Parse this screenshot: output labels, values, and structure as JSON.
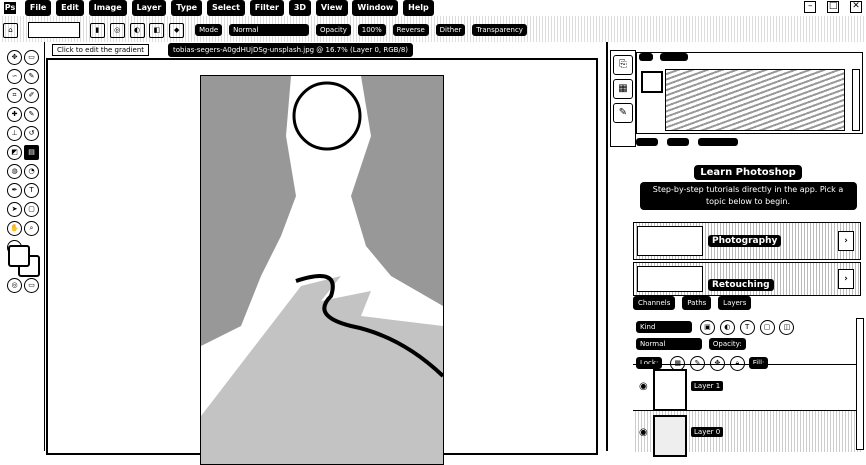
{
  "menubar": {
    "logo": "Ps",
    "items": [
      "File",
      "Edit",
      "Image",
      "Layer",
      "Type",
      "Select",
      "Filter",
      "3D",
      "View",
      "Window",
      "Help"
    ],
    "window_controls": [
      "–",
      "□",
      "✕"
    ]
  },
  "options": {
    "items": [
      "Mode",
      "Normal",
      "Opacity",
      "100%",
      "Reverse",
      "Dither",
      "Transparency"
    ]
  },
  "tooltip": {
    "text": "Click to edit the gradient"
  },
  "document": {
    "tab_label": "tobias-segers-A0gdHUjDSg-unsplash.jpg @ 16.7% (Layer 0, RGB/8)"
  },
  "side_strip": {
    "icons": [
      "history-icon",
      "libraries-icon",
      "brush-icon"
    ]
  },
  "learn": {
    "tabs": [
      "",
      "",
      ""
    ],
    "title": "Learn Photoshop",
    "body": "Step-by-step tutorials directly in the app. Pick a topic below to begin.",
    "topics": [
      {
        "label": "Photography"
      },
      {
        "label": "Retouching"
      }
    ]
  },
  "layers": {
    "tabs": [
      "Channels",
      "Paths",
      "Layers"
    ],
    "kind_label": "Kind",
    "blend_label": "Normal",
    "opacity_label": "Opacity:",
    "lock_label": "Lock:",
    "fill_label": "Fill:",
    "rows": [
      {
        "name": "Layer 1"
      },
      {
        "name": "Layer 0"
      }
    ]
  }
}
